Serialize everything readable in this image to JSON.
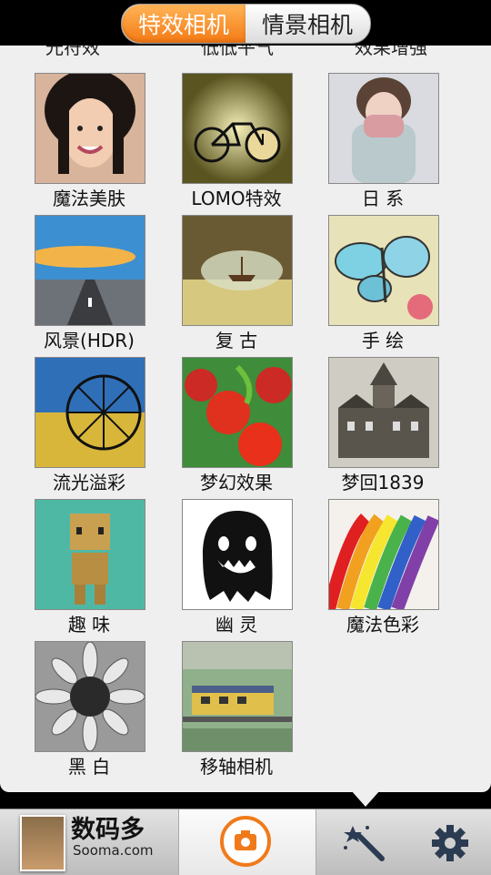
{
  "tabs": [
    {
      "label": "特效相机",
      "active": true
    },
    {
      "label": "情景相机",
      "active": false
    }
  ],
  "partial_row_labels": [
    "光符效",
    "低低平气",
    "效果增强"
  ],
  "effects": [
    {
      "label": "魔法美肤",
      "thumb": "portrait-girl-thumbnail"
    },
    {
      "label": "LOMO特效",
      "thumb": "bicycle-clock-thumbnail"
    },
    {
      "label": "日 系",
      "thumb": "girl-scarf-thumbnail"
    },
    {
      "label": "风景(HDR)",
      "thumb": "road-sky-thumbnail"
    },
    {
      "label": "复 古",
      "thumb": "bottle-ship-thumbnail"
    },
    {
      "label": "手 绘",
      "thumb": "butterfly-sketch-thumbnail"
    },
    {
      "label": "流光溢彩",
      "thumb": "ferris-wheel-thumbnail"
    },
    {
      "label": "梦幻效果",
      "thumb": "tomatoes-thumbnail"
    },
    {
      "label": "梦回1839",
      "thumb": "old-building-thumbnail"
    },
    {
      "label": "趣 味",
      "thumb": "cardboard-robot-thumbnail"
    },
    {
      "label": "幽 灵",
      "thumb": "ghost-thumbnail"
    },
    {
      "label": "魔法色彩",
      "thumb": "color-pencils-thumbnail"
    },
    {
      "label": "黑 白",
      "thumb": "sunflower-bw-thumbnail"
    },
    {
      "label": "移轴相机",
      "thumb": "train-tilt-shift-thumbnail"
    }
  ],
  "bottom_bar": {
    "watermark_title": "数码多",
    "watermark_sub": "Sooma.com",
    "camera_icon": "camera-icon",
    "wand_icon": "magic-wand-icon",
    "gear_icon": "gear-icon"
  },
  "colors": {
    "accent": "#f47a14",
    "panel": "#efefef",
    "background": "#000000"
  }
}
